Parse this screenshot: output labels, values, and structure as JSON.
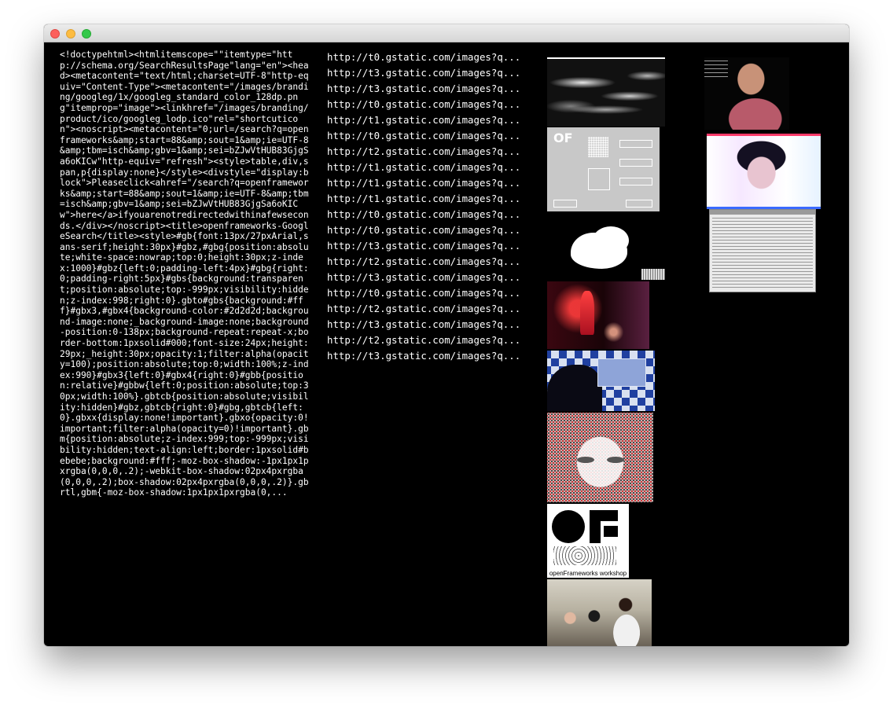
{
  "window": {
    "traffic_lights": {
      "close_color": "#fc605c",
      "minimize_color": "#fdbc40",
      "maximize_color": "#34c84a"
    }
  },
  "page_source": "<!doctypehtml><htmlitemscope=\"\"itemtype=\"http://schema.org/SearchResultsPage\"lang=\"en\"><head><metacontent=\"text/html;charset=UTF-8\"http-equiv=\"Content-Type\"><metacontent=\"/images/branding/googleg/1x/googleg_standard_color_128dp.png\"itemprop=\"image\"><linkhref=\"/images/branding/product/ico/googleg_lodp.ico\"rel=\"shortcuticon\"><noscript><metacontent=\"0;url=/search?q=openframeworks&amp;start=88&amp;sout=1&amp;ie=UTF-8&amp;tbm=isch&amp;gbv=1&amp;sei=bZJwVtHUB83GjgSa6oKICw\"http-equiv=\"refresh\"><style>table,div,span,p{display:none}</style><divstyle=\"display:block\">Pleaseclick<ahref=\"/search?q=openframeworks&amp;start=88&amp;sout=1&amp;ie=UTF-8&amp;tbm=isch&amp;gbv=1&amp;sei=bZJwVtHUB83GjgSa6oKICw\">here</a>ifyouarenotredirectedwithinafewseconds.</div></noscript><title>openframeworks-GoogleSearch</title><style>#gb{font:13px/27pxArial,sans-serif;height:30px}#gbz,#gbg{position:absolute;white-space:nowrap;top:0;height:30px;z-index:1000}#gbz{left:0;padding-left:4px}#gbg{right:0;padding-right:5px}#gbs{background:transparent;position:absolute;top:-999px;visibility:hidden;z-index:998;right:0}.gbto#gbs{background:#fff}#gbx3,#gbx4{background-color:#2d2d2d;background-image:none;_background-image:none;background-position:0-138px;background-repeat:repeat-x;border-bottom:1pxsolid#000;font-size:24px;height:29px;_height:30px;opacity:1;filter:alpha(opacity=100);position:absolute;top:0;width:100%;z-index:990}#gbx3{left:0}#gbx4{right:0}#gbb{position:relative}#gbbw{left:0;position:absolute;top:30px;width:100%}.gbtcb{position:absolute;visibility:hidden}#gbz,gbtcb{right:0}#gbg,gbtcb{left:0}.gbxx{display:none!important}.gbxo{opacity:0!important;filter:alpha(opacity=0)!important}.gbm{position:absolute;z-index:999;top:-999px;visibility:hidden;text-align:left;border:1pxsolid#bebebe;background:#fff;-moz-box-shadow:-1px1px1pxrgba(0,0,0,.2);-webkit-box-shadow:02px4pxrgba(0,0,0,.2);box-shadow:02px4pxrgba(0,0,0,.2)}.gbrtl,gbm{-moz-box-shadow:1px1px1pxrgba(0,...",
  "image_urls": [
    "http://t0.gstatic.com/images?q...",
    "http://t3.gstatic.com/images?q...",
    "http://t3.gstatic.com/images?q...",
    "http://t0.gstatic.com/images?q...",
    "http://t1.gstatic.com/images?q...",
    "http://t0.gstatic.com/images?q...",
    "http://t2.gstatic.com/images?q...",
    "http://t1.gstatic.com/images?q...",
    "http://t1.gstatic.com/images?q...",
    "http://t1.gstatic.com/images?q...",
    "http://t0.gstatic.com/images?q...",
    "http://t0.gstatic.com/images?q...",
    "http://t3.gstatic.com/images?q...",
    "http://t2.gstatic.com/images?q...",
    "http://t3.gstatic.com/images?q...",
    "http://t0.gstatic.com/images?q...",
    "http://t2.gstatic.com/images?q...",
    "http://t3.gstatic.com/images?q...",
    "http://t2.gstatic.com/images?q...",
    "http://t3.gstatic.com/images?q..."
  ],
  "thumbnails": {
    "of_logo_caption": "openFrameworks workshop",
    "diagram_logo": "OF"
  }
}
